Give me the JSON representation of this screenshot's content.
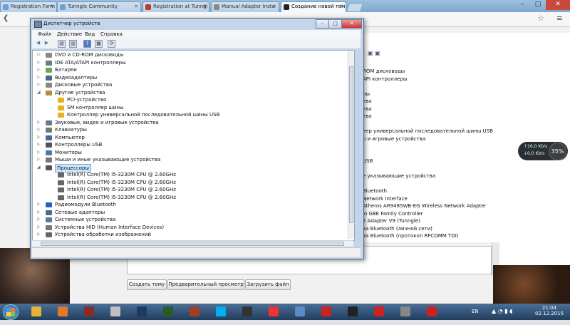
{
  "browser": {
    "tabs": [
      {
        "label": "Registration Form - Tu",
        "color": "#6aa1d6",
        "active": false
      },
      {
        "label": "Tunngle Community",
        "color": "#6aa1d6",
        "active": false
      },
      {
        "label": "Registration at Tunngl",
        "color": "#c0392b",
        "active": false
      },
      {
        "label": "Manual Adapter Insta",
        "color": "#8a8a8a",
        "active": false
      },
      {
        "label": "Создание новой темы",
        "color": "#222",
        "active": true
      }
    ],
    "nav_back_glyph": "à"
  },
  "device_manager": {
    "title": "Диспетчер устройств",
    "menu": [
      "Файл",
      "Действие",
      "Вид",
      "Справка"
    ],
    "tree": [
      {
        "label": "DVD и CD-ROM дисководы",
        "level": 1,
        "expander": "▷",
        "icon": "#8a8a8a"
      },
      {
        "label": "IDE ATA/ATAPI контроллеры",
        "level": 1,
        "expander": "▷",
        "icon": "#6a7a8a"
      },
      {
        "label": "Батареи",
        "level": 1,
        "expander": "▷",
        "icon": "#6aa84f"
      },
      {
        "label": "Видеоадаптеры",
        "level": 1,
        "expander": "▷",
        "icon": "#4a6a8a"
      },
      {
        "label": "Дисковые устройства",
        "level": 1,
        "expander": "▷",
        "icon": "#888"
      },
      {
        "label": "Другие устройства",
        "level": 1,
        "expander": "◢",
        "icon": "#b58d3d"
      },
      {
        "label": "PCI-устройство",
        "level": 2,
        "expander": "",
        "icon": "#e6b422"
      },
      {
        "label": "SM контроллер шины",
        "level": 2,
        "expander": "",
        "icon": "#e6b422"
      },
      {
        "label": "Контроллер универсальной последовательной шины USB",
        "level": 2,
        "expander": "",
        "icon": "#e6b422"
      },
      {
        "label": "Звуковые, видео и игровые устройства",
        "level": 1,
        "expander": "▷",
        "icon": "#6a7a8a"
      },
      {
        "label": "Клавиатуры",
        "level": 1,
        "expander": "▷",
        "icon": "#777"
      },
      {
        "label": "Компьютер",
        "level": 1,
        "expander": "▷",
        "icon": "#4a6a9a"
      },
      {
        "label": "Контроллеры USB",
        "level": 1,
        "expander": "▷",
        "icon": "#555"
      },
      {
        "label": "Мониторы",
        "level": 1,
        "expander": "▷",
        "icon": "#4a7ab0"
      },
      {
        "label": "Мыши и иные указывающие устройства",
        "level": 1,
        "expander": "▷",
        "icon": "#777"
      },
      {
        "label": "Процессоры",
        "level": 1,
        "expander": "◢",
        "icon": "#555",
        "selected": true
      },
      {
        "label": "Intel(R) Core(TM) i5-3230M CPU @ 2.60GHz",
        "level": 2,
        "expander": "",
        "icon": "#666"
      },
      {
        "label": "Intel(R) Core(TM) i5-3230M CPU @ 2.60GHz",
        "level": 2,
        "expander": "",
        "icon": "#666"
      },
      {
        "label": "Intel(R) Core(TM) i5-3230M CPU @ 2.60GHz",
        "level": 2,
        "expander": "",
        "icon": "#666"
      },
      {
        "label": "Intel(R) Core(TM) i5-3230M CPU @ 2.60GHz",
        "level": 2,
        "expander": "",
        "icon": "#666"
      },
      {
        "label": "Радиомодули Bluetooth",
        "level": 1,
        "expander": "▷",
        "icon": "#2a5fbf"
      },
      {
        "label": "Сетевые адаптеры",
        "level": 1,
        "expander": "▷",
        "icon": "#4a6a8a"
      },
      {
        "label": "Системные устройства",
        "level": 1,
        "expander": "▷",
        "icon": "#5a7a9a"
      },
      {
        "label": "Устройства HID (Human Interface Devices)",
        "level": 1,
        "expander": "▷",
        "icon": "#777"
      },
      {
        "label": "Устройства обработки изображений",
        "level": 1,
        "expander": "▷",
        "icon": "#666"
      }
    ]
  },
  "background_window": {
    "lines": [
      {
        "text": "ROM дисководы",
        "row": 0
      },
      {
        "text": "API контроллеры",
        "row": 1
      },
      {
        "text": "ры",
        "row": 3
      },
      {
        "text": "тва",
        "row": 4
      },
      {
        "text": "тва",
        "row": 5
      },
      {
        "text": "тва",
        "row": 6
      },
      {
        "text": "тер универсальной последовательной шины USB",
        "row": 8
      },
      {
        "text": "о и игровые устройства",
        "row": 9
      },
      {
        "text": "USB",
        "row": 12
      },
      {
        "text": "е указывающие устройства",
        "row": 14
      },
      {
        "text": "Bluetooth",
        "row": 16
      },
      {
        "text": "Network Interface",
        "row": 17
      },
      {
        "text": "Atheros AR9485WB-EG Wireless Network Adapter",
        "row": 18
      },
      {
        "text": "io GBE Family Controller",
        "row": 19
      },
      {
        "text": "2 Adapter V9 (Tunngle)",
        "row": 20
      },
      {
        "text": "ва Bluetooth (личной сети)",
        "row": 21
      },
      {
        "text": "ва Bluetooth (протокол RFCOMM TDI)",
        "row": 22
      },
      {
        "text": "тства",
        "row": 23
      }
    ]
  },
  "network_widget": {
    "upload": "16,0",
    "upload_unit": "Kb/s",
    "download": "0,0",
    "download_unit": "Kb/s",
    "percent": "35%"
  },
  "forum": {
    "buttons": [
      "Создать тему",
      "Предварительный просмотр",
      "Загрузить файл"
    ]
  },
  "taskbar": {
    "lang": "EN",
    "time": "21:04",
    "date": "02.12.2015",
    "apps": [
      {
        "name": "folder-icon",
        "color": "#e8b13c"
      },
      {
        "name": "media-player-icon",
        "color": "#e07a2a"
      },
      {
        "name": "game-icon",
        "color": "#8a2a2a"
      },
      {
        "name": "shield-icon",
        "color": "#bfbfbf"
      },
      {
        "name": "steam-icon",
        "color": "#1d3a5f"
      },
      {
        "name": "counter-icon",
        "color": "#2a5a2a"
      },
      {
        "name": "game-icon-2",
        "color": "#a04020"
      },
      {
        "name": "skype-icon",
        "color": "#00aff0"
      },
      {
        "name": "bug-icon",
        "color": "#333"
      },
      {
        "name": "yandex-icon",
        "color": "#e33"
      },
      {
        "name": "paint-icon",
        "color": "#5a8ac8"
      },
      {
        "name": "app-red-icon",
        "color": "#c22"
      },
      {
        "name": "3dp-chip-icon",
        "color": "#222"
      },
      {
        "name": "app-red-icon-2",
        "color": "#c22"
      },
      {
        "name": "monitor-icon",
        "color": "#888"
      },
      {
        "name": "app-red-icon-3",
        "color": "#c22"
      }
    ]
  }
}
